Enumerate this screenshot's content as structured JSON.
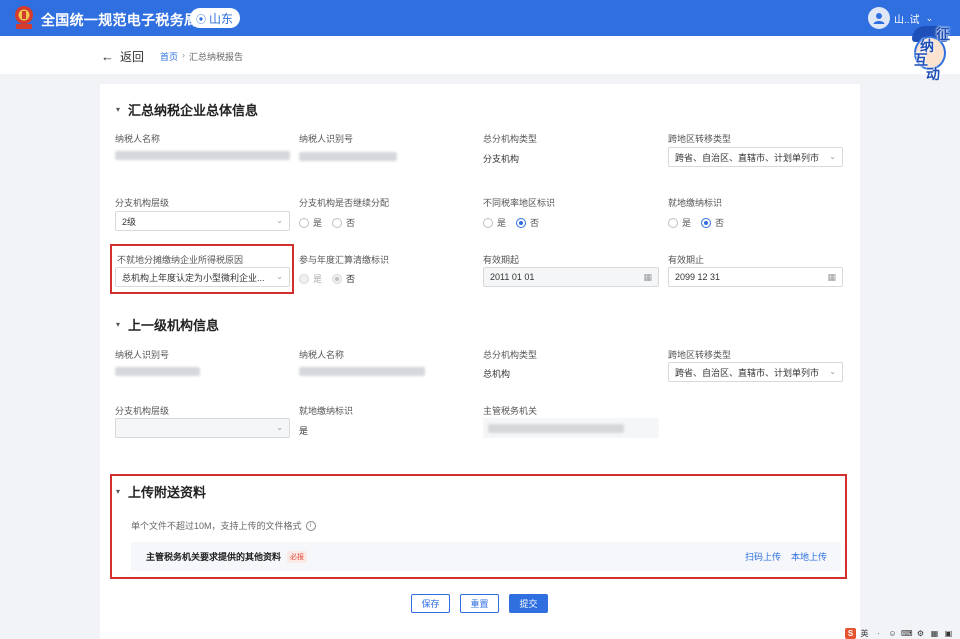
{
  "app": {
    "title": "全国统一规范电子税务局",
    "region": "山东",
    "user_name": "山..试",
    "mascot_lines": [
      "征",
      "纳",
      "互",
      "动"
    ]
  },
  "nav": {
    "back_label": "返回",
    "breadcrumb": [
      "首页",
      "汇总纳税报告"
    ]
  },
  "section1": {
    "title": "汇总纳税企业总体信息",
    "fields": {
      "taxpayer_name_label": "纳税人名称",
      "taxpayer_id_label": "纳税人识别号",
      "org_type_label": "总分机构类型",
      "org_type_value": "分支机构",
      "cross_region_label": "跨地区转移类型",
      "cross_region_value": "跨省、自治区、直辖市、计划单列市",
      "branch_level_label": "分支机构层级",
      "branch_level_value": "2级",
      "continue_alloc_label": "分支机构是否继续分配",
      "diff_rate_label": "不同税率地区标识",
      "local_pay_label": "就地缴纳标识",
      "no_local_reason_label": "不就地分摊缴纳企业所得税原因",
      "no_local_reason_value": "总机构上年度认定为小型微利企业...",
      "annual_settle_label": "参与年度汇算清缴标识",
      "valid_from_label": "有效期起",
      "valid_from_value": "2011 01 01",
      "valid_to_label": "有效期止",
      "valid_to_value": "2099 12 31"
    }
  },
  "section2": {
    "title": "上一级机构信息",
    "fields": {
      "taxpayer_id_label": "纳税人识别号",
      "taxpayer_name_label": "纳税人名称",
      "org_type_label": "总分机构类型",
      "org_type_value": "总机构",
      "cross_region_label": "跨地区转移类型",
      "cross_region_value": "跨省、自治区、直辖市、计划单列市",
      "branch_level_label": "分支机构层级",
      "local_pay_label": "就地缴纳标识",
      "local_pay_value": "是",
      "tax_authority_label": "主管税务机关"
    }
  },
  "section3": {
    "title": "上传附送资料",
    "hint": "单个文件不超过10M，支持上传的文件格式",
    "doc_name": "主管税务机关要求提供的其他资料",
    "required_tag": "必报",
    "scan_upload": "扫码上传",
    "local_upload": "本地上传"
  },
  "radio": {
    "yes": "是",
    "no": "否"
  },
  "radio_states": {
    "continue_alloc": "none",
    "diff_rate": "no",
    "local_pay": "no",
    "annual_settle": "no"
  },
  "actions": {
    "save": "保存",
    "reset": "重置",
    "submit": "提交"
  },
  "colors": {
    "brand": "#2f6fe0",
    "highlight_box": "#d32f2f",
    "required": "#e04b3a"
  },
  "taskbar": [
    "S",
    "英",
    "·",
    "☺",
    "⌨",
    "⚙",
    "▦",
    "▣"
  ]
}
